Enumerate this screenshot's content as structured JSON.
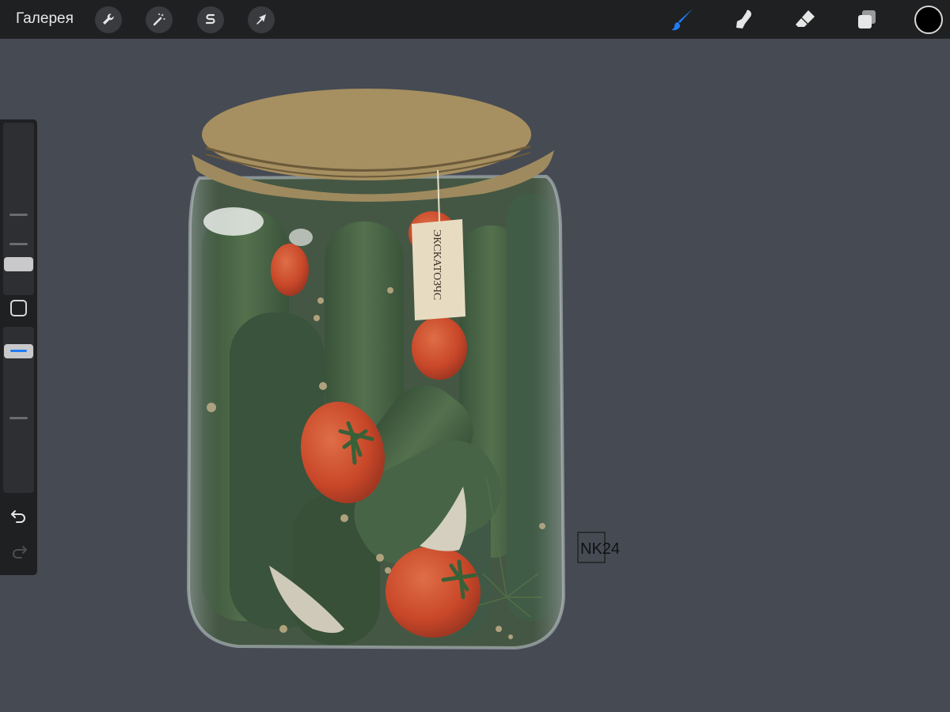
{
  "toolbar": {
    "gallery_label": "Галерея",
    "left_tools": [
      {
        "name": "actions",
        "icon": "wrench-icon"
      },
      {
        "name": "adjustments",
        "icon": "magic-wand-icon"
      },
      {
        "name": "selection",
        "icon": "selection-s-icon"
      },
      {
        "name": "transform",
        "icon": "arrow-cursor-icon"
      }
    ],
    "right_tools": [
      {
        "name": "brush",
        "icon": "brush-icon",
        "active": true
      },
      {
        "name": "smudge",
        "icon": "smudge-finger-icon",
        "active": false
      },
      {
        "name": "eraser",
        "icon": "eraser-icon",
        "active": false
      },
      {
        "name": "layers",
        "icon": "layers-icon",
        "active": false
      }
    ],
    "current_color": "#000000",
    "active_color": "#1f7cf5"
  },
  "sidebar": {
    "brush_size_slider": {
      "icon": "size-slider"
    },
    "modifier_button": {
      "icon": "square-modifier-icon"
    },
    "opacity_slider": {
      "icon": "opacity-slider"
    },
    "undo": {
      "icon": "undo-arrow-icon"
    },
    "redo": {
      "icon": "redo-arrow-icon",
      "enabled": false
    }
  },
  "artwork": {
    "tag_text": "ЭКСКАТОЗЧС",
    "signature": "NK24",
    "palette": {
      "background": "#454a53",
      "lid": "#a68f60",
      "cucumber": "#3d5a35",
      "tomato": "#d8421e"
    }
  }
}
